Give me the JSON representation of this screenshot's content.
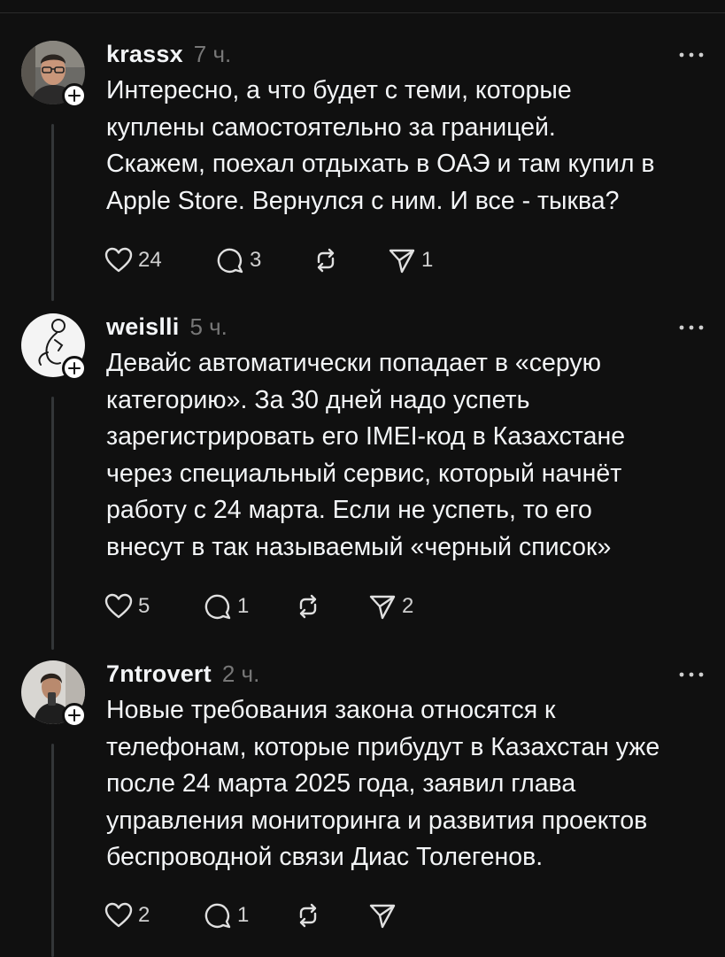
{
  "posts": [
    {
      "username": "krassx",
      "time": "7 ч.",
      "avatar": "avatar-man-glasses",
      "lines": [
        "Интересно, а что будет с теми, которые",
        "куплены самостоятельно за границей.",
        "Скажем, поехал отдыхать в ОАЭ и там купил в",
        "Apple Store. Вернулся с ним. И все - тыква?"
      ],
      "likes": "24",
      "replies": "3",
      "reposts": "",
      "shares": "1"
    },
    {
      "username": "weislli",
      "time": "5 ч.",
      "avatar": "avatar-line-drawing",
      "lines": [
        "Девайс автоматически попадает в «серую",
        "категорию». За 30 дней надо успеть",
        "зарегистрировать его IMEI-код в Казахстане",
        "через специальный сервис, который начнёт",
        "работу с 24 марта. Если не успеть, то его",
        "внесут в так называемый «черный список»"
      ],
      "likes": "5",
      "replies": "1",
      "reposts": "",
      "shares": "2"
    },
    {
      "username": "7ntrovert",
      "time": "2 ч.",
      "avatar": "avatar-mirror-selfie",
      "lines": [
        "Новые требования закона относятся к",
        "телефонам, которые прибудут в Казахстан уже",
        "после 24 марта 2025 года, заявил глава",
        "управления мониторинга и развития проектов",
        "беспроводной связи Диас Толегенов."
      ],
      "likes": "2",
      "replies": "1",
      "reposts": "",
      "shares": ""
    }
  ],
  "colors": {
    "background": "#101010",
    "text": "#f3f5f7",
    "muted": "#777777",
    "thread_line": "#333638"
  }
}
